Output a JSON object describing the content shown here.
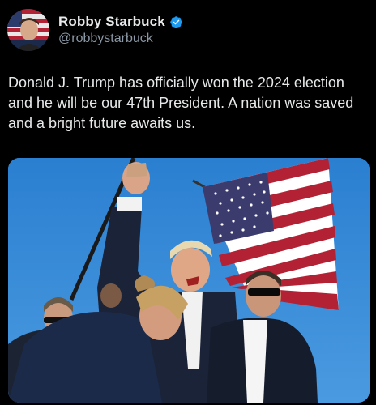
{
  "post": {
    "author": {
      "display_name": "Robby Starbuck",
      "handle": "@robbystarbuck",
      "verified": true,
      "verified_icon": "verified-badge-icon",
      "avatar_description": "avatar"
    },
    "text": "Donald J. Trump has officially won the 2024 election and he will be our 47th President. A nation was saved and a bright future awaits us.",
    "media": {
      "type": "photo",
      "alt_name": "rally-photo"
    }
  },
  "colors": {
    "background": "#000000",
    "text_primary": "#e7e9ea",
    "text_secondary": "#8b98a5",
    "verified_blue": "#1d9bf0",
    "sky": "#2f86d4"
  }
}
